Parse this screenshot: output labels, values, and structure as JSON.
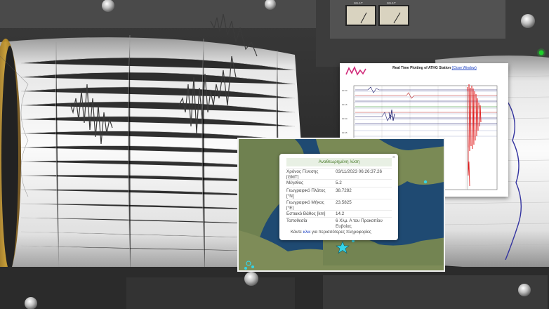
{
  "plot": {
    "title": "Real Time Plotting of ATHG Station",
    "link": "(Close Window)"
  },
  "meters": {
    "left_label": "SS-1T",
    "right_label": "SS-1T"
  },
  "popup": {
    "header": "Αναθεωρημένη λύση",
    "close": "×",
    "rows": [
      {
        "label": "Χρόνος Γένεσης [GMT]",
        "value": "03/11/2023 06:26:37.26"
      },
      {
        "label": "Μέγεθος",
        "value": "5.2"
      },
      {
        "label": "Γεωγραφικό Πλάτος [°N]",
        "value": "38.7282"
      },
      {
        "label": "Γεωγραφικό Μήκος [°E]",
        "value": "23.5825"
      },
      {
        "label": "Εστιακό Βάθος [km]",
        "value": "14.2"
      },
      {
        "label": "Τοποθεσία",
        "value": "6 Χλμ. Α του Προκοπίου Ευβοίας"
      }
    ],
    "footer_prefix": "Κάντε ",
    "footer_link": "κλικ",
    "footer_suffix": " για περισσότερες πληροφορίες"
  },
  "colors": {
    "map_sea": "#1f4a72",
    "map_land": "#7a8a55",
    "epicenter": "#35d4e8",
    "seismogram_red": "#e01818"
  }
}
